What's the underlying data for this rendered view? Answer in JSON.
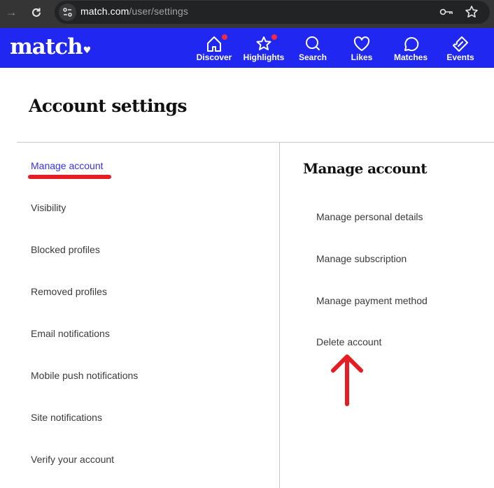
{
  "browser": {
    "url_host": "match.com",
    "url_path": "/user/settings",
    "icons": [
      "forward-icon",
      "reload-icon",
      "site-settings-icon",
      "password-key-icon",
      "bookmark-star-icon"
    ]
  },
  "header": {
    "logo_text": "match",
    "logo_heart": "♥",
    "brand_color": "#1f27f0",
    "nav": [
      {
        "label": "Discover",
        "icon": "home-icon",
        "has_dot": true
      },
      {
        "label": "Highlights",
        "icon": "star-icon",
        "has_dot": true
      },
      {
        "label": "Search",
        "icon": "search-icon",
        "has_dot": false
      },
      {
        "label": "Likes",
        "icon": "heart-icon",
        "has_dot": false
      },
      {
        "label": "Matches",
        "icon": "chat-bubble-icon",
        "has_dot": false
      },
      {
        "label": "Events",
        "icon": "ticket-icon",
        "has_dot": false
      }
    ]
  },
  "page": {
    "title": "Account settings"
  },
  "sidebar": {
    "active_index": 0,
    "active_color": "#3533e8",
    "items": [
      {
        "label": "Manage account"
      },
      {
        "label": "Visibility"
      },
      {
        "label": "Blocked profiles"
      },
      {
        "label": "Removed profiles"
      },
      {
        "label": "Email notifications"
      },
      {
        "label": "Mobile push notifications"
      },
      {
        "label": "Site notifications"
      },
      {
        "label": "Verify your account"
      }
    ]
  },
  "panel": {
    "title": "Manage account",
    "items": [
      {
        "label": "Manage personal details"
      },
      {
        "label": "Manage subscription"
      },
      {
        "label": "Manage payment method"
      },
      {
        "label": "Delete account"
      }
    ]
  },
  "annotations": {
    "color": "#e51c24",
    "underline_target": "Manage account",
    "arrow_target": "Delete account"
  }
}
